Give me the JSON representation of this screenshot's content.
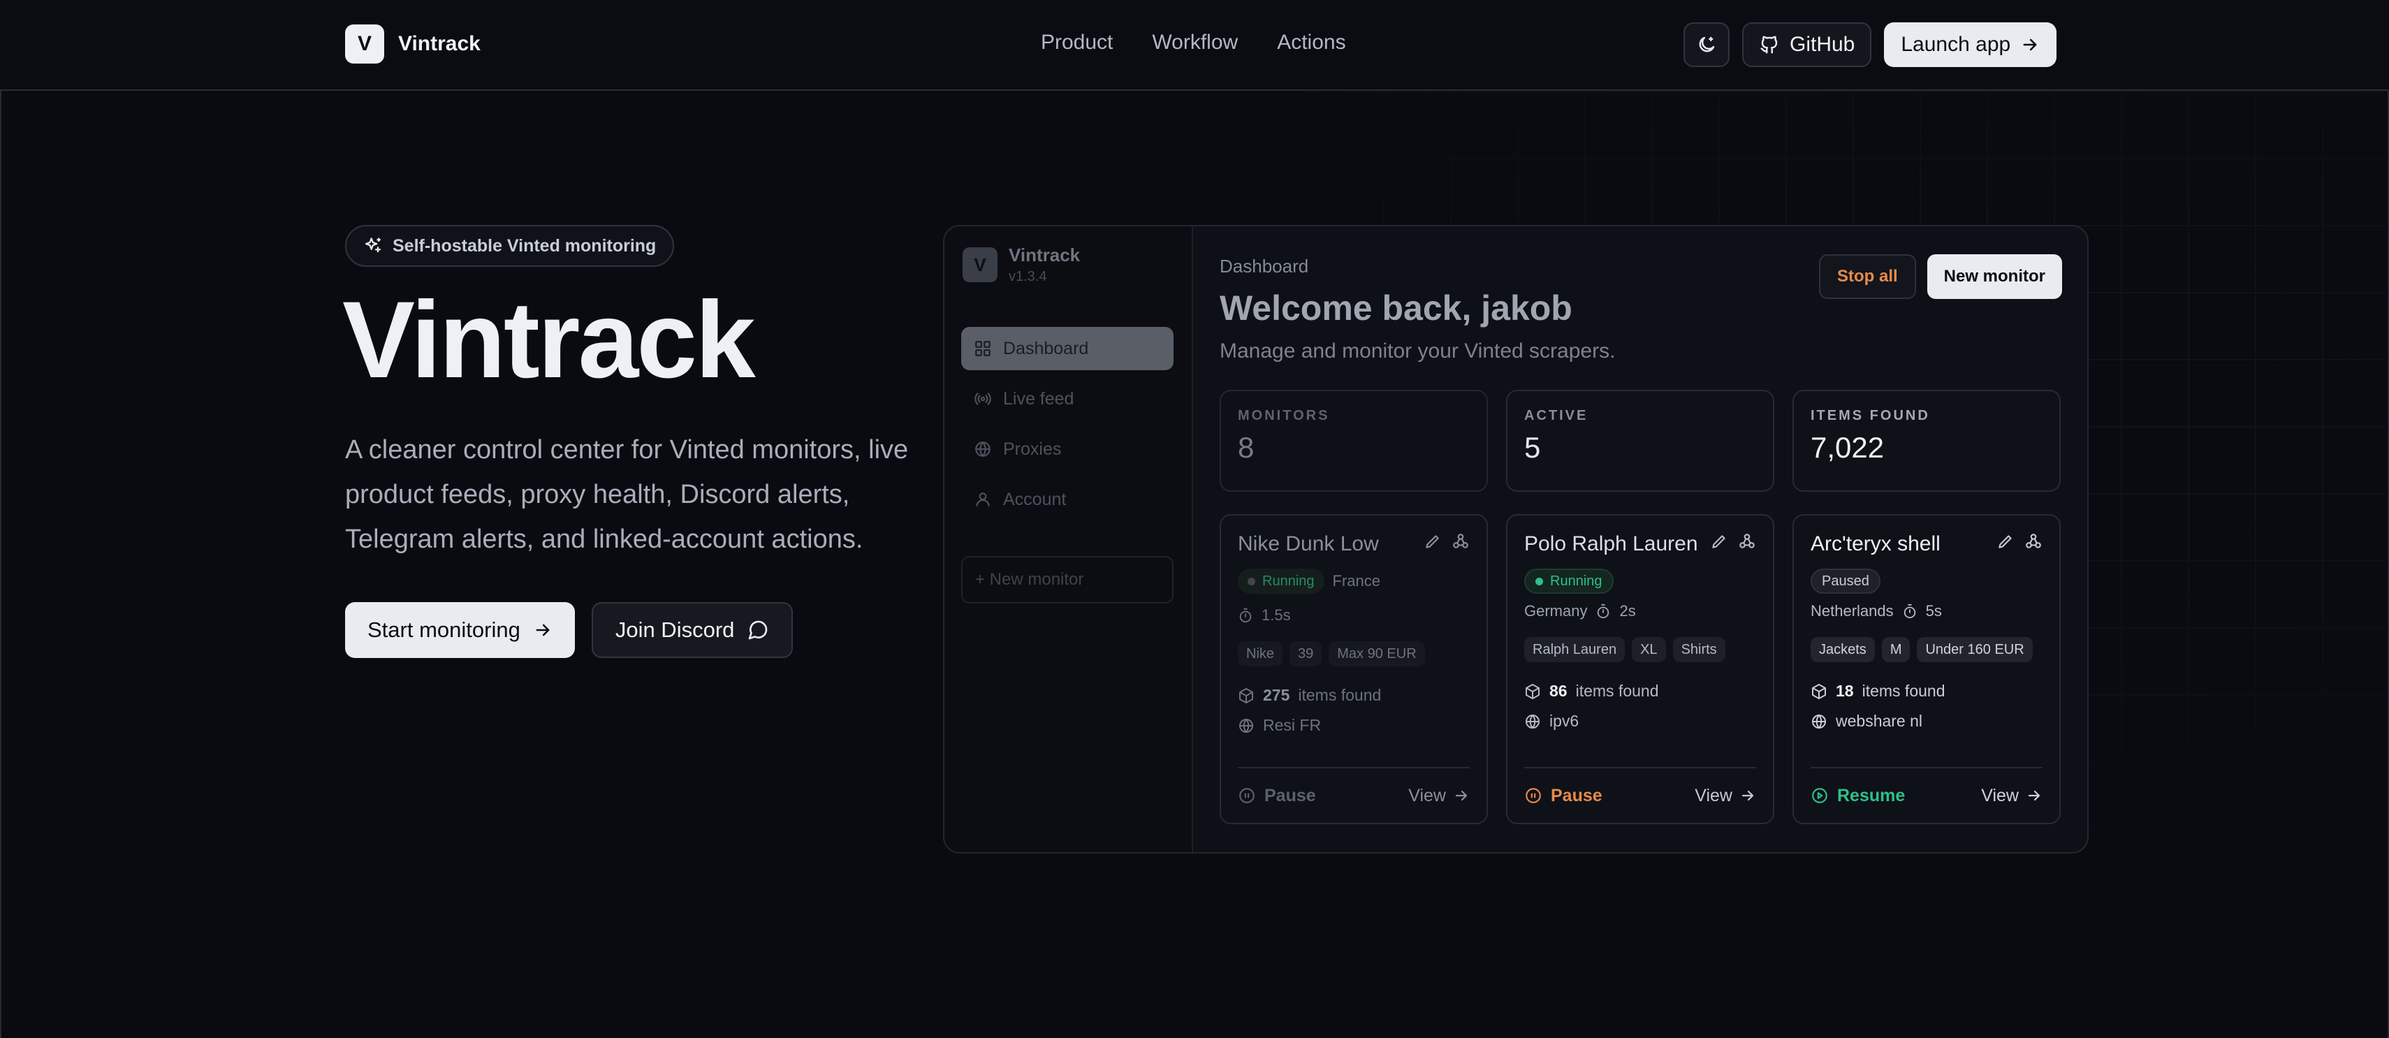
{
  "nav": {
    "brand_letter": "V",
    "brand_name": "Vintrack",
    "links": [
      "Product",
      "Workflow",
      "Actions"
    ],
    "github_label": "GitHub",
    "launch_label": "Launch app"
  },
  "hero": {
    "pill": "Self-hostable Vinted monitoring",
    "title": "Vintrack",
    "subtitle": "A cleaner control center for Vinted monitors, live product feeds, proxy health, Discord alerts, Telegram alerts, and linked-account actions.",
    "start_label": "Start monitoring",
    "discord_label": "Join Discord"
  },
  "dashboard": {
    "sidebar": {
      "logo_letter": "V",
      "app_name": "Vintrack",
      "version": "v1.3.4",
      "items": [
        "Dashboard",
        "Live feed",
        "Proxies",
        "Account"
      ],
      "new_monitor": "+ New monitor"
    },
    "breadcrumb": "Dashboard",
    "welcome": "Welcome back, jakob",
    "subtitle": "Manage and monitor your Vinted scrapers.",
    "stop_all": "Stop all",
    "new_monitor": "New monitor",
    "stats": [
      {
        "label": "MONITORS",
        "value": "8"
      },
      {
        "label": "ACTIVE",
        "value": "5"
      },
      {
        "label": "ITEMS FOUND",
        "value": "7,022"
      }
    ],
    "monitors": [
      {
        "title": "Nike Dunk Low",
        "status": "Running",
        "country": "France",
        "interval": "1.5s",
        "tags": [
          "Nike",
          "39",
          "Max 90 EUR"
        ],
        "items_count": "275",
        "items_label": "items found",
        "proxy": "Resi FR",
        "action": "Pause",
        "view": "View"
      },
      {
        "title": "Polo Ralph Lauren",
        "status": "Running",
        "country": "Germany",
        "interval": "2s",
        "tags": [
          "Ralph Lauren",
          "XL",
          "Shirts"
        ],
        "items_count": "86",
        "items_label": "items found",
        "proxy": "ipv6",
        "action": "Pause",
        "view": "View"
      },
      {
        "title": "Arc'teryx shell",
        "status": "Paused",
        "country": "Netherlands",
        "interval": "5s",
        "tags": [
          "Jackets",
          "M",
          "Under 160 EUR"
        ],
        "items_count": "18",
        "items_label": "items found",
        "proxy": "webshare nl",
        "action": "Resume",
        "view": "View"
      }
    ]
  },
  "colors": {
    "background": "#090b11",
    "running": "#2fbf8a",
    "pause": "#e88a4a",
    "resume": "#2fbf8a"
  }
}
